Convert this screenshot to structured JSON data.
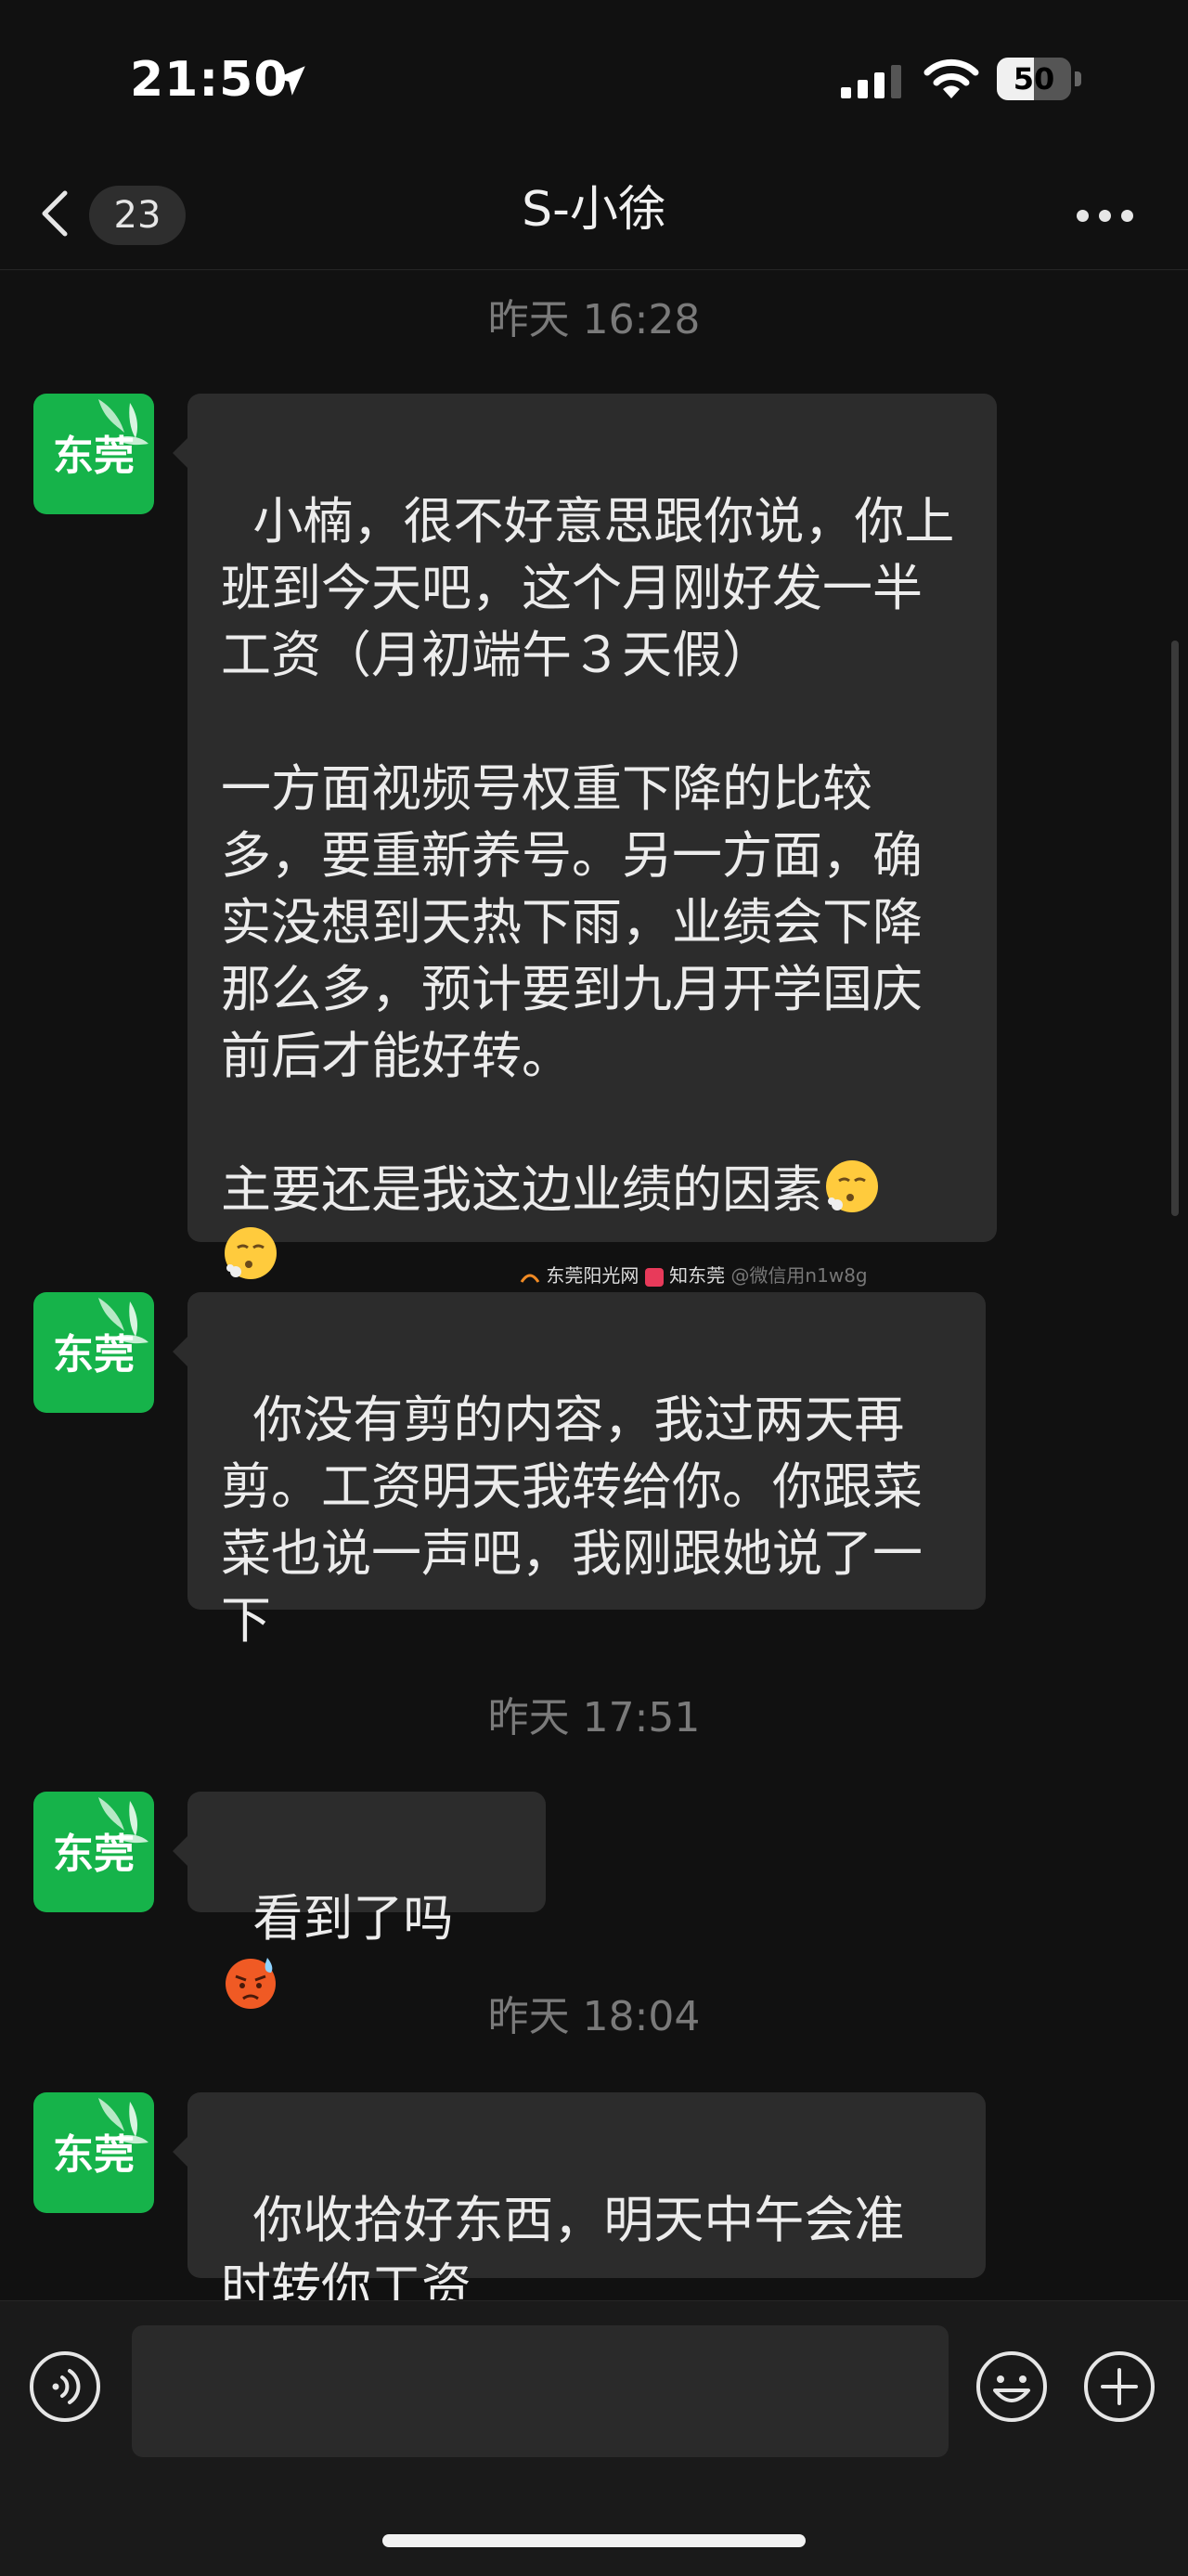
{
  "status_bar": {
    "time": "21:50",
    "battery": "50",
    "battery_level": 0.5
  },
  "header": {
    "unread_count": "23",
    "title": "S-小徐"
  },
  "messages": [
    {
      "timestamp": "昨天 16:28",
      "sender_avatar_text": "东莞",
      "text": "小楠，很不好意思跟你说，你上班到今天吧，这个月刚好发一半工资（月初端午３天假）\n\n一方面视频号权重下降的比较多，要重新养号。另一方面，确实没想到天热下雨，业绩会下降那么多，预计要到九月开学国庆前后才能好转。\n\n主要还是我这边业绩的因素",
      "emoji": [
        "face-exhaling",
        "face-exhaling"
      ]
    },
    {
      "sender_avatar_text": "东莞",
      "text": "你没有剪的内容，我过两天再剪。工资明天我转给你。你跟菜菜也说一声吧，我刚跟她说了一下"
    },
    {
      "timestamp": "昨天 17:51",
      "sender_avatar_text": "东莞",
      "text": "看到了吗",
      "emoji": [
        "angry-sweat-face"
      ]
    },
    {
      "timestamp": "昨天 18:04",
      "sender_avatar_text": "东莞",
      "text": "你收拾好东西，明天中午会准时转你工资"
    }
  ],
  "watermark": {
    "site": "东莞阳光网",
    "site_url": "sun0769.com",
    "brand": "知东莞",
    "handle": "@微信用n1w8g"
  },
  "colors": {
    "background": "#111111",
    "bubble": "#2c2c2c",
    "avatar_green": "#16b34a",
    "timestamp": "#7a7a7a"
  }
}
